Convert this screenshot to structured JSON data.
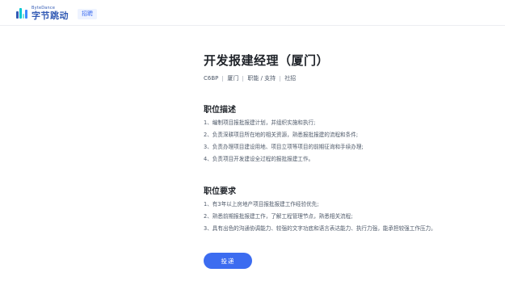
{
  "header": {
    "brand_en": "ByteDance",
    "brand_cn": "字节跳动",
    "recruit_tag": "招聘",
    "brand_colors": [
      "#325ab4",
      "#00c8d2",
      "#78e6dc",
      "#3c8cff"
    ]
  },
  "job": {
    "title": "开发报建经理（厦门）",
    "meta": {
      "code": "C6BP",
      "city": "厦门",
      "category": "职能 / 支持",
      "type": "社招"
    }
  },
  "description": {
    "title": "职位描述",
    "items": [
      "1、编制项目报批报建计划，并组织实施和执行;",
      "2、负责深耕项目所在地的相关资源，熟悉报批报建的流程和条件;",
      "3、负责办理项目建设用地、项目立项等项目的前期征询和手续办理;",
      "4、负责项目开发建设全过程的报批报建工作。"
    ]
  },
  "requirements": {
    "title": "职位要求",
    "items": [
      "1、有3年以上房地产项目报批报建工作经验优先;",
      "2、熟悉前期报批报建工作，了解工程管理节点，熟悉相关流程;",
      "3、具有出色的沟通协调能力、较强的文字功底和语言表达能力、执行力强，能承担较强工作压力。"
    ]
  },
  "actions": {
    "apply_label": "投递",
    "accent_color": "#3c6cf0"
  }
}
